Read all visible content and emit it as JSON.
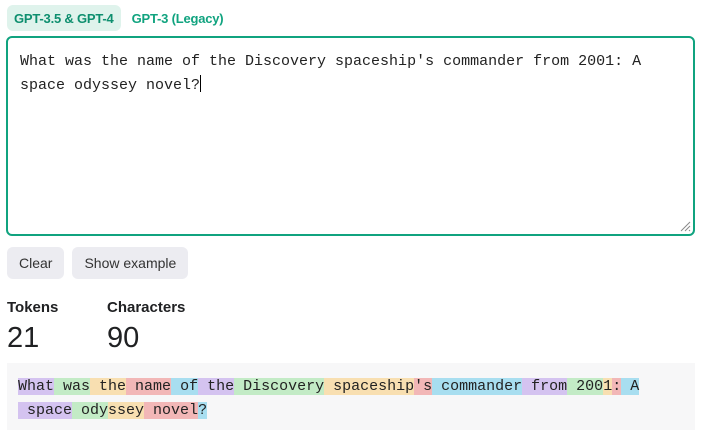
{
  "tabs": [
    {
      "label": "GPT-3.5 & GPT-4",
      "active": true
    },
    {
      "label": "GPT-3 (Legacy)",
      "active": false
    }
  ],
  "editor": {
    "value": "What was the name of the Discovery spaceship's commander from 2001: A space odyssey novel?"
  },
  "buttons": {
    "clear": "Clear",
    "show_example": "Show example"
  },
  "stats": {
    "tokens_label": "Tokens",
    "tokens_value": "21",
    "characters_label": "Characters",
    "characters_value": "90"
  },
  "tokens": {
    "line1": [
      "What",
      " was",
      " the",
      " name",
      " of",
      " the",
      " Discovery",
      " spaceship",
      "'s",
      " commander",
      " from",
      " 200",
      "1",
      ":",
      " A"
    ],
    "line2": [
      " space",
      " ody",
      "ssey",
      " novel",
      "?"
    ],
    "colors": [
      "#d4c3f0",
      "#c3ebc6",
      "#f8dfb1",
      "#f2b7b7",
      "#a8def0"
    ]
  }
}
